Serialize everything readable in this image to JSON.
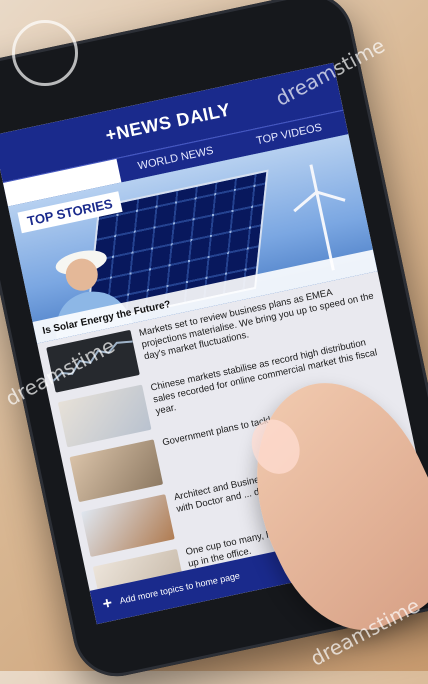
{
  "app": {
    "title": "+NEWS DAILY",
    "tabs": [
      {
        "label": "WORLD NEWS",
        "active": false
      },
      {
        "label": "TOP VIDEOS",
        "active": false
      }
    ],
    "hero": {
      "label": "TOP STORIES",
      "caption": "Is Solar Energy the Future?"
    },
    "stories": [
      {
        "text": "Markets set to review business plans as EMEA projections materialise. We bring you up to speed on the day's market fluctuations."
      },
      {
        "text": "Chinese markets stabilise as record high distribution sales recorded for online commercial market this fiscal year."
      },
      {
        "text": "Government plans to tackle ... will cuts make ..."
      },
      {
        "text": "Architect and Business ... list of highest earning ... year with Doctor and ... down the ranks."
      },
      {
        "text": "One cup too many, how the ... content in your drink is ... up in the office."
      }
    ],
    "footer": {
      "text": "Add more topics to home page",
      "dots": "•••"
    }
  },
  "watermark": {
    "text": "dreamstime"
  },
  "colors": {
    "brand": "#1a2a8c",
    "screen_bg": "#e9e9ef"
  }
}
